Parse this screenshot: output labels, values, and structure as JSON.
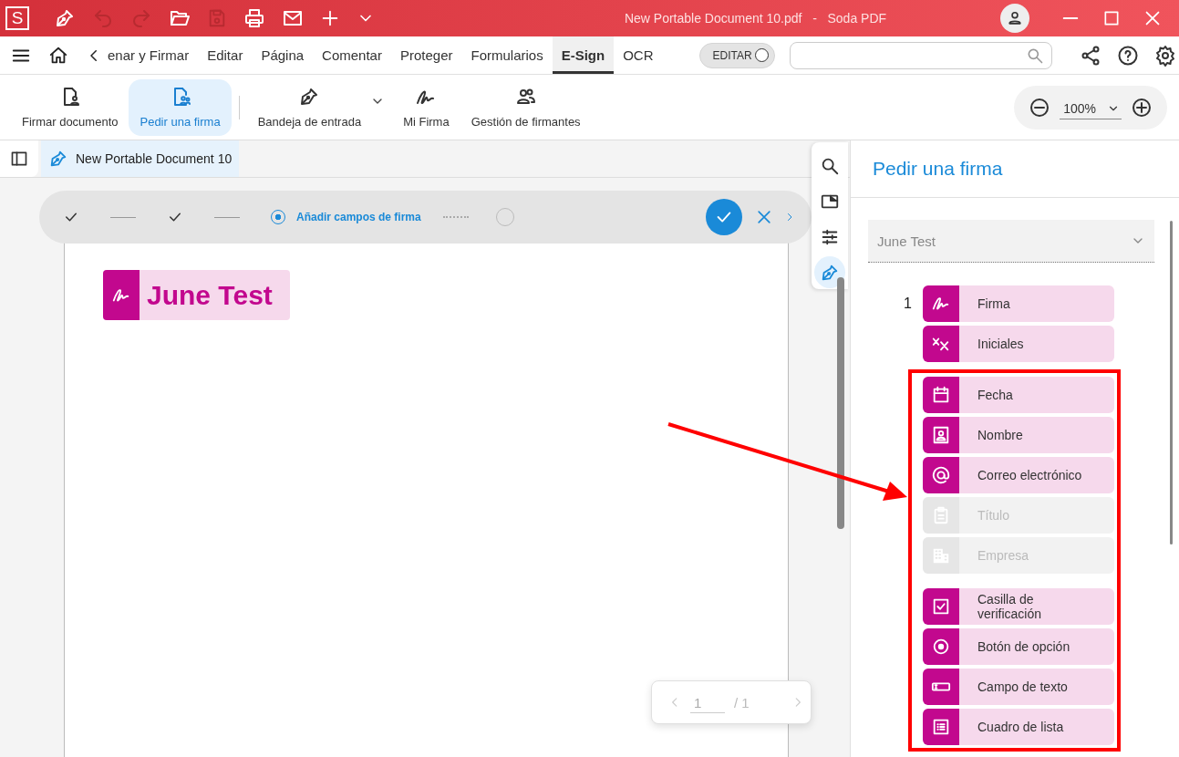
{
  "title_bar": {
    "app_letter": "S",
    "title": "New Portable Document 10.pdf   -   Soda PDF"
  },
  "menu_tabs": [
    {
      "label": "enar y Firmar",
      "selected": false
    },
    {
      "label": "Editar",
      "selected": false
    },
    {
      "label": "Página",
      "selected": false
    },
    {
      "label": "Comentar",
      "selected": false
    },
    {
      "label": "Proteger",
      "selected": false
    },
    {
      "label": "Formularios",
      "selected": false
    },
    {
      "label": "E-Sign",
      "selected": true
    },
    {
      "label": "OCR",
      "selected": false
    }
  ],
  "edit_toggle": {
    "label": "EDITAR",
    "on": false
  },
  "ribbon": [
    {
      "kind": "sign-doc",
      "label": "Firmar documento",
      "selected": false,
      "dropdown": false
    },
    {
      "kind": "request",
      "label": "Pedir una firma",
      "selected": true,
      "dropdown": false
    },
    {
      "kind": "inbox",
      "label": "Bandeja de entrada",
      "selected": false,
      "dropdown": true
    },
    {
      "kind": "my-sig",
      "label": "Mi Firma",
      "selected": false,
      "dropdown": false
    },
    {
      "kind": "signers",
      "label": "Gestión de firmantes",
      "selected": false,
      "dropdown": false
    }
  ],
  "zoom": {
    "value": "100%"
  },
  "document_tab": {
    "title": "New Portable Document 10"
  },
  "stepper": {
    "steps": [
      {
        "kind": "done"
      },
      {
        "kind": "done"
      },
      {
        "kind": "current",
        "label": "Añadir campos de firma"
      },
      {
        "kind": "pending"
      }
    ]
  },
  "signature_field": {
    "name": "June Test"
  },
  "pager": {
    "page": "1",
    "total": "/ 1"
  },
  "side_tools": [
    {
      "kind": "search",
      "selected": false
    },
    {
      "kind": "panel",
      "selected": false
    },
    {
      "kind": "sliders",
      "selected": false
    },
    {
      "kind": "pen",
      "selected": true
    }
  ],
  "panel": {
    "title": "Pedir una firma",
    "signer": "June Test",
    "field_groups": [
      {
        "highlighted": false,
        "fields": [
          {
            "kind": "signature",
            "number": "1",
            "label": "Firma",
            "disabled": false
          },
          {
            "kind": "initials",
            "label": "Iniciales",
            "disabled": false
          }
        ]
      },
      {
        "highlighted": true,
        "fields": [
          {
            "kind": "date",
            "label": "Fecha",
            "disabled": false
          },
          {
            "kind": "name",
            "label": "Nombre",
            "disabled": false
          },
          {
            "kind": "email",
            "label": "Correo electrónico",
            "disabled": false
          },
          {
            "kind": "title",
            "label": "Título",
            "disabled": true
          },
          {
            "kind": "company",
            "label": "Empresa",
            "disabled": true
          }
        ]
      },
      {
        "highlighted": true,
        "fields": [
          {
            "kind": "checkbox",
            "label": "Casilla de verificación",
            "disabled": false
          },
          {
            "kind": "radio",
            "label": "Botón de opción",
            "disabled": false
          },
          {
            "kind": "textbox",
            "label": "Campo de texto",
            "disabled": false
          },
          {
            "kind": "listbox",
            "label": "Cuadro de lista",
            "disabled": false
          }
        ]
      }
    ]
  }
}
